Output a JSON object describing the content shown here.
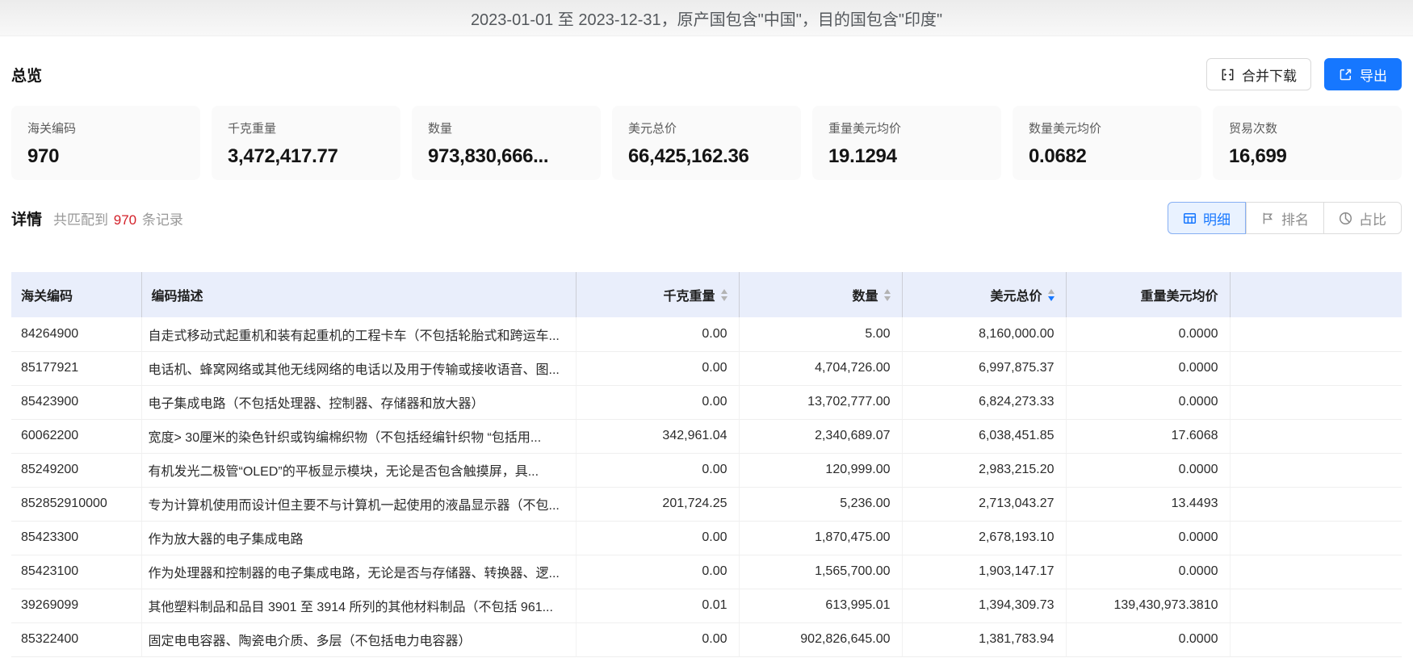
{
  "colors": {
    "accent_blue": "#1677ff",
    "count_red": "#d32029",
    "table_header_bg": "#e9eefb",
    "card_bg": "#fafafa"
  },
  "titlebar": {
    "title": "2023-01-01 至 2023-12-31，原产国包含\"中国\"，目的国包含\"印度\""
  },
  "overview": {
    "title": "总览",
    "merge_download_label": "合并下载",
    "export_label": "导出",
    "stats": [
      {
        "label": "海关编码",
        "value": "970"
      },
      {
        "label": "千克重量",
        "value": "3,472,417.77"
      },
      {
        "label": "数量",
        "value": "973,830,666..."
      },
      {
        "label": "美元总价",
        "value": "66,425,162.36"
      },
      {
        "label": "重量美元均价",
        "value": "19.1294"
      },
      {
        "label": "数量美元均价",
        "value": "0.0682"
      },
      {
        "label": "贸易次数",
        "value": "16,699"
      }
    ]
  },
  "details": {
    "title": "详情",
    "match_prefix": "共匹配到",
    "match_count": "970",
    "match_suffix": "条记录",
    "tabs": [
      {
        "label": "明细",
        "icon": "table-icon",
        "active": true
      },
      {
        "label": "排名",
        "icon": "rank-icon",
        "active": false
      },
      {
        "label": "占比",
        "icon": "pie-icon",
        "active": false
      }
    ]
  },
  "table": {
    "columns": [
      {
        "key": "code",
        "label": "海关编码",
        "sortable": false
      },
      {
        "key": "desc",
        "label": "编码描述",
        "sortable": false
      },
      {
        "key": "kg",
        "label": "千克重量",
        "sortable": true,
        "sort": "none"
      },
      {
        "key": "qty",
        "label": "数量",
        "sortable": true,
        "sort": "none"
      },
      {
        "key": "usd",
        "label": "美元总价",
        "sortable": true,
        "sort": "desc"
      },
      {
        "key": "unit",
        "label": "重量美元均价",
        "sortable": false
      },
      {
        "key": "spacer",
        "label": "",
        "sortable": false
      }
    ],
    "rows": [
      {
        "code": "84264900",
        "desc": "自走式移动式起重机和装有起重机的工程卡车（不包括轮胎式和跨运车...",
        "kg": "0.00",
        "qty": "5.00",
        "usd": "8,160,000.00",
        "unit": "0.0000"
      },
      {
        "code": "85177921",
        "desc": "电话机、蜂窝网络或其他无线网络的电话以及用于传输或接收语音、图...",
        "kg": "0.00",
        "qty": "4,704,726.00",
        "usd": "6,997,875.37",
        "unit": "0.0000"
      },
      {
        "code": "85423900",
        "desc": "电子集成电路（不包括处理器、控制器、存储器和放大器）",
        "kg": "0.00",
        "qty": "13,702,777.00",
        "usd": "6,824,273.33",
        "unit": "0.0000"
      },
      {
        "code": "60062200",
        "desc": "宽度> 30厘米的染色针织或钩编棉织物（不包括经编针织物 “包括用...",
        "kg": "342,961.04",
        "qty": "2,340,689.07",
        "usd": "6,038,451.85",
        "unit": "17.6068"
      },
      {
        "code": "85249200",
        "desc": "有机发光二极管“OLED”的平板显示模块，无论是否包含触摸屏，具...",
        "kg": "0.00",
        "qty": "120,999.00",
        "usd": "2,983,215.20",
        "unit": "0.0000"
      },
      {
        "code": "852852910000",
        "desc": "专为计算机使用而设计但主要不与计算机一起使用的液晶显示器（不包...",
        "kg": "201,724.25",
        "qty": "5,236.00",
        "usd": "2,713,043.27",
        "unit": "13.4493"
      },
      {
        "code": "85423300",
        "desc": "作为放大器的电子集成电路",
        "kg": "0.00",
        "qty": "1,870,475.00",
        "usd": "2,678,193.10",
        "unit": "0.0000"
      },
      {
        "code": "85423100",
        "desc": "作为处理器和控制器的电子集成电路，无论是否与存储器、转换器、逻...",
        "kg": "0.00",
        "qty": "1,565,700.00",
        "usd": "1,903,147.17",
        "unit": "0.0000"
      },
      {
        "code": "39269099",
        "desc": "其他塑料制品和品目 3901 至 3914 所列的其他材料制品（不包括 961...",
        "kg": "0.01",
        "qty": "613,995.01",
        "usd": "1,394,309.73",
        "unit": "139,430,973.3810"
      },
      {
        "code": "85322400",
        "desc": "固定电电容器、陶瓷电介质、多层（不包括电力电容器）",
        "kg": "0.00",
        "qty": "902,826,645.00",
        "usd": "1,381,783.94",
        "unit": "0.0000"
      }
    ]
  }
}
